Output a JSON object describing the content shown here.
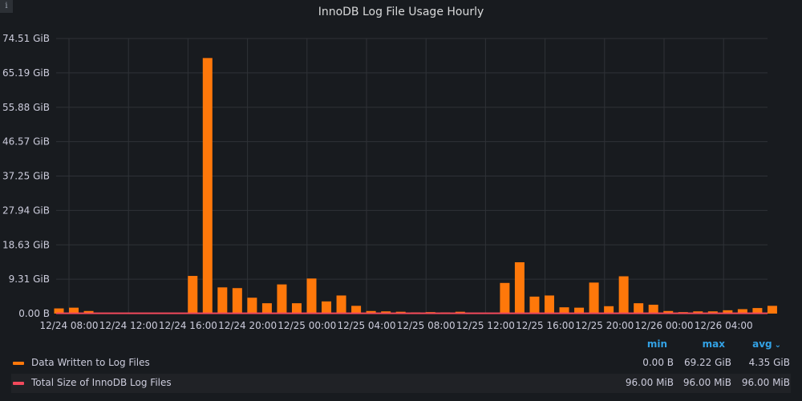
{
  "panel": {
    "title": "InnoDB Log File Usage Hourly",
    "info_icon": "info-icon"
  },
  "chart_data": {
    "type": "bar",
    "ylim": [
      0,
      74.51
    ],
    "y_ticks": [
      "0.00 B",
      "9.31 GiB",
      "18.63 GiB",
      "27.94 GiB",
      "37.25 GiB",
      "46.57 GiB",
      "55.88 GiB",
      "65.19 GiB",
      "74.51 GiB"
    ],
    "x_tick_labels": [
      "12/24 08:00",
      "12/24 12:00",
      "12/24 16:00",
      "12/24 20:00",
      "12/25 00:00",
      "12/25 04:00",
      "12/25 08:00",
      "12/25 12:00",
      "12/25 16:00",
      "12/25 20:00",
      "12/26 00:00",
      "12/26 04:00"
    ],
    "grid": true,
    "legend_position": "bottom",
    "series": [
      {
        "name": "Data Written to Log Files",
        "color": "#ff780a",
        "values": [
          1.4,
          1.6,
          0.7,
          0.1,
          0.1,
          0.1,
          0.1,
          0.1,
          0.1,
          10.2,
          69.22,
          7.1,
          6.9,
          4.3,
          2.8,
          7.9,
          2.8,
          9.5,
          3.3,
          4.9,
          2.1,
          0.7,
          0.6,
          0.5,
          0.3,
          0.4,
          0.3,
          0.5,
          0.2,
          0.2,
          8.3,
          13.9,
          4.6,
          4.9,
          1.7,
          1.6,
          8.4,
          2.0,
          10.1,
          2.8,
          2.4,
          0.7,
          0.4,
          0.6,
          0.6,
          0.9,
          1.2,
          1.5,
          2.1
        ]
      },
      {
        "name": "Total Size of InnoDB Log Files",
        "color": "#f2495c",
        "values_mib": 96.0
      }
    ]
  },
  "legend": {
    "headers": {
      "min": "min",
      "max": "max",
      "avg": "avg"
    },
    "sort_icon": "chevron-down-icon",
    "rows": [
      {
        "name": "Data Written to Log Files",
        "color": "#ff780a",
        "min": "0.00 B",
        "max": "69.22 GiB",
        "avg": "4.35 GiB"
      },
      {
        "name": "Total Size of InnoDB Log Files",
        "color": "#f2495c",
        "min": "96.00 MiB",
        "max": "96.00 MiB",
        "avg": "96.00 MiB"
      }
    ]
  }
}
